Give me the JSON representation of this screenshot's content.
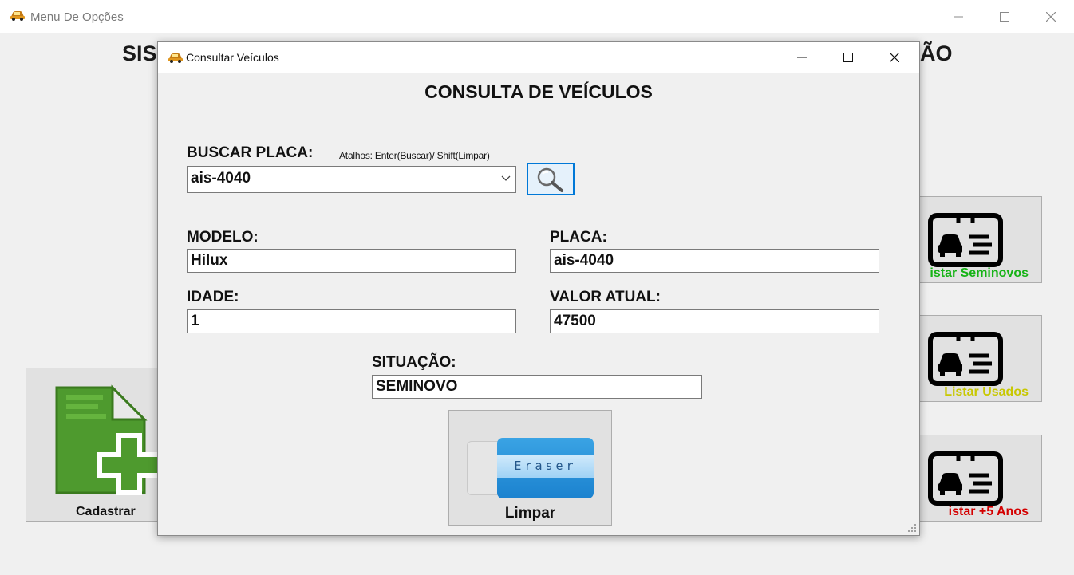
{
  "main_window": {
    "title": "Menu De Opções",
    "heading_left": "SIS",
    "heading_right": "ÃO",
    "cards": {
      "cadastrar": "Cadastrar",
      "seminovos": "istar Seminovos",
      "usados": "Listar Usados",
      "cinco_anos": "istar +5 Anos"
    },
    "card_colors": {
      "seminovos": "#16b316",
      "usados": "#c8c800",
      "cinco_anos": "#d40000"
    }
  },
  "dialog": {
    "title": "Consultar Veículos",
    "heading": "CONSULTA DE VEÍCULOS",
    "search": {
      "label": "BUSCAR PLACA:",
      "shortcuts": "Atalhos: Enter(Buscar)/ Shift(Limpar)",
      "value": "ais-4040",
      "button_icon": "magnifier-icon"
    },
    "fields": {
      "modelo": {
        "label": "MODELO:",
        "value": "Hilux"
      },
      "placa": {
        "label": "PLACA:",
        "value": "ais-4040"
      },
      "idade": {
        "label": "IDADE:",
        "value": "1"
      },
      "valor_atual": {
        "label": "VALOR ATUAL:",
        "value": "47500"
      },
      "situacao": {
        "label": "SITUAÇÃO:",
        "value": "SEMINOVO"
      }
    },
    "clear_button": {
      "label": "Limpar",
      "icon_text": "Eraser"
    }
  },
  "colors": {
    "focus_border": "#0078d7",
    "window_bg": "#f0f0f0"
  }
}
